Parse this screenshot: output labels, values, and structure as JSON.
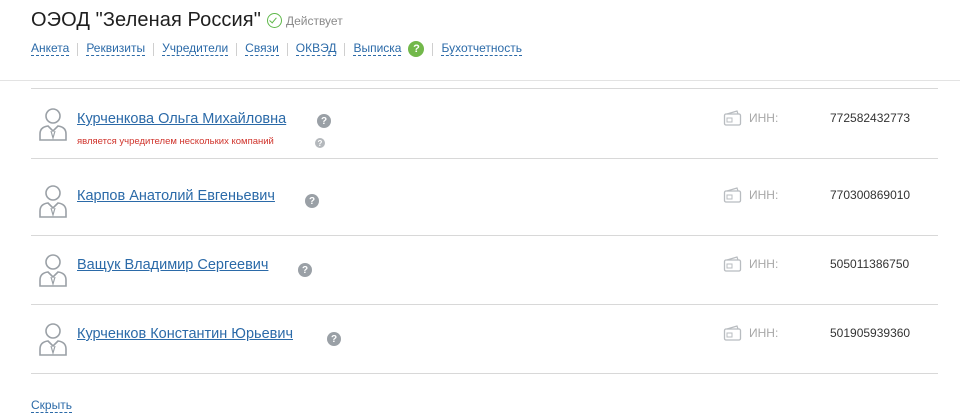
{
  "company": {
    "name": "ОЭОД \"Зеленая Россия\"",
    "status": "Действует",
    "status_color": "#5fb84a"
  },
  "nav": {
    "items": [
      "Анкета",
      "Реквизиты",
      "Учредители",
      "Связи",
      "ОКВЭД",
      "Выписка",
      "Бухотчетность"
    ],
    "help_label": "?"
  },
  "founders": [
    {
      "name": "Курченкова Ольга Михайловна",
      "note": "является учредителем нескольких компаний",
      "inn_label": "ИНН:",
      "inn": "772582432773"
    },
    {
      "name": "Карпов Анатолий Евгеньевич",
      "inn_label": "ИНН:",
      "inn": "770300869010"
    },
    {
      "name": "Ващук Владимир Сергеевич",
      "inn_label": "ИНН:",
      "inn": "505011386750"
    },
    {
      "name": "Курченков Константин Юрьевич",
      "inn_label": "ИНН:",
      "inn": "501905939360"
    }
  ],
  "help_glyph": "?",
  "hide_label": "Скрыть",
  "colors": {
    "link": "#2b6aa8",
    "note": "#d0342c",
    "help_green": "#72b84a"
  }
}
